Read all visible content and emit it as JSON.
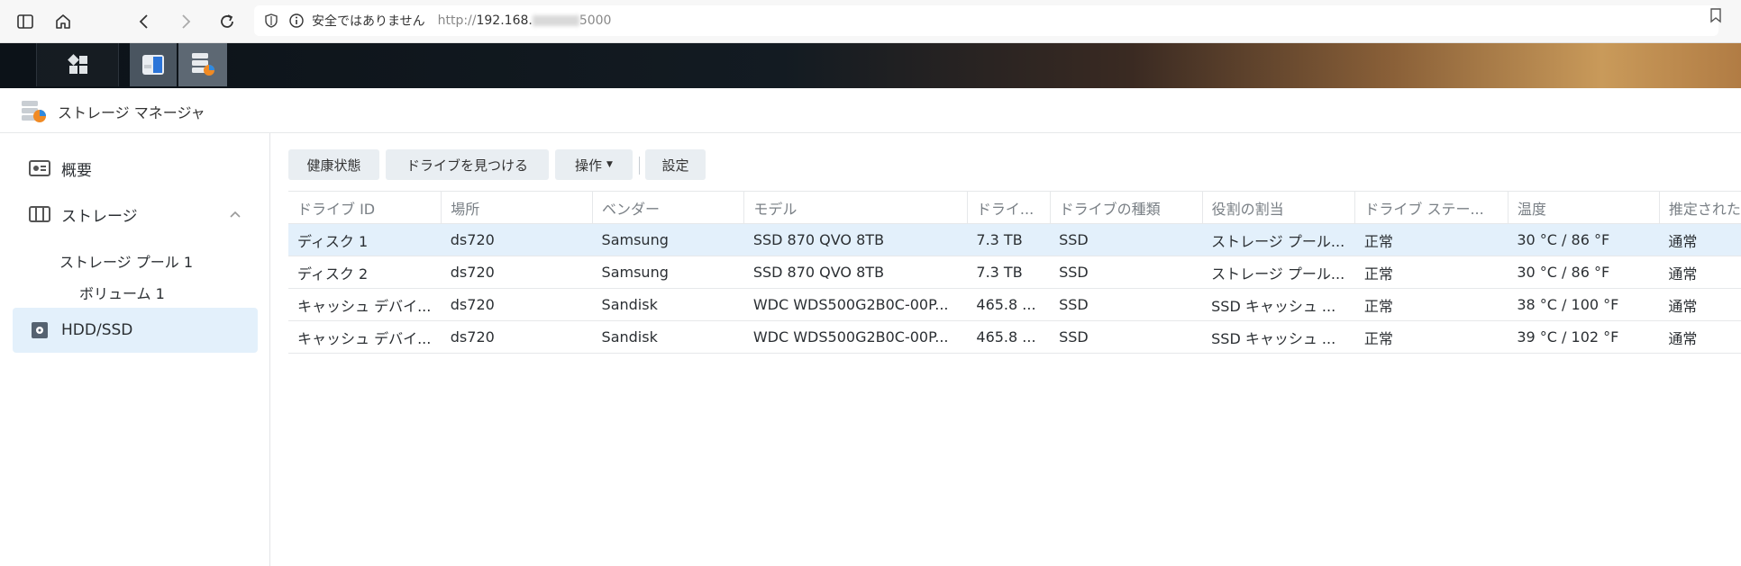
{
  "browser": {
    "security_warning": "安全ではありません",
    "url_prefix": "http://",
    "url_host": "192.168.",
    "url_port": "5000"
  },
  "window": {
    "title": "ストレージ マネージャ"
  },
  "sidebar": {
    "items": [
      {
        "label": "概要"
      },
      {
        "label": "ストレージ"
      },
      {
        "label": "ストレージ プール 1"
      },
      {
        "label": "ボリューム 1"
      },
      {
        "label": "HDD/SSD"
      }
    ]
  },
  "toolbar": {
    "health": "健康状態",
    "locate": "ドライブを見つける",
    "action": "操作",
    "settings": "設定"
  },
  "table": {
    "columns": [
      "ドライブ ID",
      "場所",
      "ベンダー",
      "モデル",
      "ドライ...",
      "ドライブの種類",
      "役割の割当",
      "ドライブ ステー...",
      "温度",
      "推定された"
    ],
    "rows": [
      [
        "ディスク 1",
        "ds720",
        "Samsung",
        "SSD 870 QVO 8TB",
        "7.3 TB",
        "SSD",
        "ストレージ プール...",
        "正常",
        "30 °C / 86 °F",
        "通常"
      ],
      [
        "ディスク 2",
        "ds720",
        "Samsung",
        "SSD 870 QVO 8TB",
        "7.3 TB",
        "SSD",
        "ストレージ プール...",
        "正常",
        "30 °C / 86 °F",
        "通常"
      ],
      [
        "キャッシュ デバイ...",
        "ds720",
        "Sandisk",
        "WDC WDS500G2B0C-00P...",
        "465.8 ...",
        "SSD",
        "SSD キャッシュ ...",
        "正常",
        "38 °C / 100 °F",
        "通常"
      ],
      [
        "キャッシュ デバイ...",
        "ds720",
        "Sandisk",
        "WDC WDS500G2B0C-00P...",
        "465.8 ...",
        "SSD",
        "SSD キャッシュ ...",
        "正常",
        "39 °C / 102 °F",
        "通常"
      ]
    ]
  },
  "colors": {
    "accent": "#e3f0fb",
    "status_ok": "#1f9e1f"
  }
}
